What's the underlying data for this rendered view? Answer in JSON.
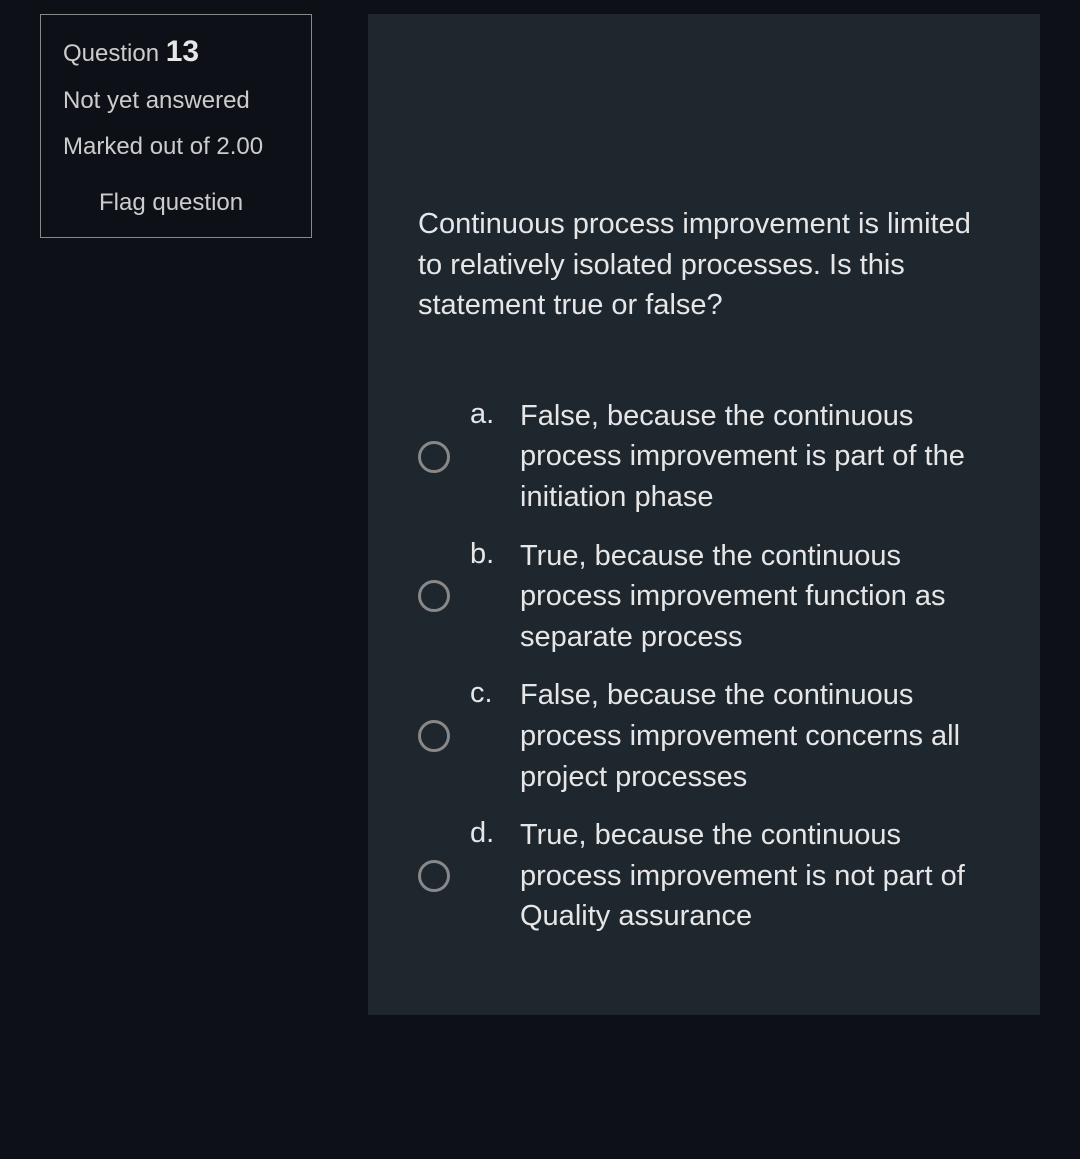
{
  "info": {
    "question_label": "Question",
    "question_number": "13",
    "status": "Not yet answered",
    "marks": "Marked out of 2.00",
    "flag": "Flag question"
  },
  "question_text": "Continuous process improvement is limited to relatively isolated processes. Is this statement true or false?",
  "answers": [
    {
      "letter": "a.",
      "text": "False, because the continuous process improvement is part of the initiation phase"
    },
    {
      "letter": "b.",
      "text": "True, because the continuous process improvement function as separate process"
    },
    {
      "letter": "c.",
      "text": "False, because the continuous process improvement concerns all project processes"
    },
    {
      "letter": "d.",
      "text": "True, because the continuous process improvement is not part of Quality assurance"
    }
  ]
}
